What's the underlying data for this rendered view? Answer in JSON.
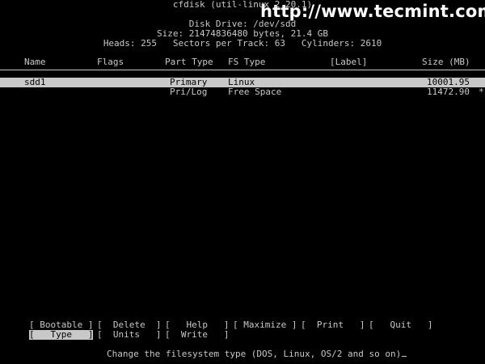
{
  "app": {
    "title": "cfdisk (util-linux 2.20.1)",
    "disk_drive": "Disk Drive: /dev/sdd",
    "size_line": "Size: 21474836480 bytes, 21.4 GB",
    "geometry_line": "Heads: 255   Sectors per Track: 63   Cylinders: 2610"
  },
  "watermark": "http://www.tecmint.com",
  "columns": {
    "name": "Name",
    "flags": "Flags",
    "part_type": "Part Type",
    "fs_type": "FS Type",
    "label": "[Label]",
    "size": "Size (MB)"
  },
  "partitions": [
    {
      "name": "sdd1",
      "flags": "",
      "part_type": "Primary",
      "fs_type": "Linux",
      "label": "",
      "size": "10001.95",
      "marker": ""
    },
    {
      "name": "",
      "flags": "",
      "part_type": "Pri/Log",
      "fs_type": "Free Space",
      "label": "",
      "size": "11472.90",
      "marker": "*"
    }
  ],
  "menu": {
    "bootable": "[ Bootable ]",
    "delete": "[  Delete  ]",
    "help": "[   Help   ]",
    "maximize": "[ Maximize ]",
    "print": "[  Print   ]",
    "quit": "[   Quit   ]",
    "type": "[   Type   ]",
    "units": "[  Units   ]",
    "write": "[  Write   ]"
  },
  "status_text": "Change the filesystem type (DOS, Linux, OS/2 and so on)",
  "colors": {
    "background": "#000000",
    "foreground": "#c8c8c8",
    "highlight_bg": "#c8c8c8",
    "highlight_fg": "#000000",
    "watermark": "#ffffff"
  }
}
